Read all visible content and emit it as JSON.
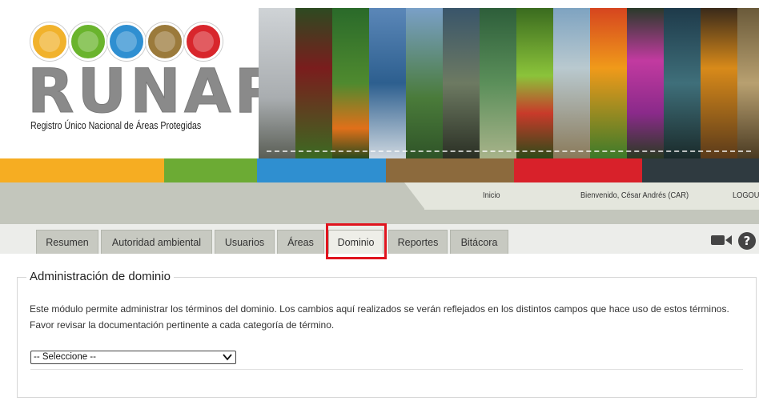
{
  "logo": {
    "word": "RUNAP",
    "subtitle": "Registro Único Nacional de Áreas Protegidas",
    "circle_colors": [
      "#f1b22c",
      "#6ab42d",
      "#2f8fd1",
      "#9b7a3b",
      "#d8262c"
    ]
  },
  "colorbar": [
    "#f6ad22",
    "#6cab34",
    "#2f8fd0",
    "#8c6a3d",
    "#d8212a",
    "#2f3a40"
  ],
  "top_nav": {
    "home": "Inicio",
    "welcome": "Bienvenido, César Andrés (CAR)",
    "logout": "LOGOU"
  },
  "tabs": [
    {
      "label": "Resumen"
    },
    {
      "label": "Autoridad ambiental"
    },
    {
      "label": "Usuarios"
    },
    {
      "label": "Áreas"
    },
    {
      "label": "Dominio"
    },
    {
      "label": "Reportes"
    },
    {
      "label": "Bitácora"
    }
  ],
  "active_tab": "Dominio",
  "icons": {
    "video": "video-camera-icon",
    "help": "help-icon"
  },
  "section": {
    "title": "Administración de dominio",
    "description": "Este módulo permite administrar los términos del dominio. Los cambios aquí realizados se verán reflejados en los distintos campos que hace uso de estos términos. Favor revisar la documentación pertinente a cada categoría de término.",
    "select_value": "-- Seleccione --"
  }
}
